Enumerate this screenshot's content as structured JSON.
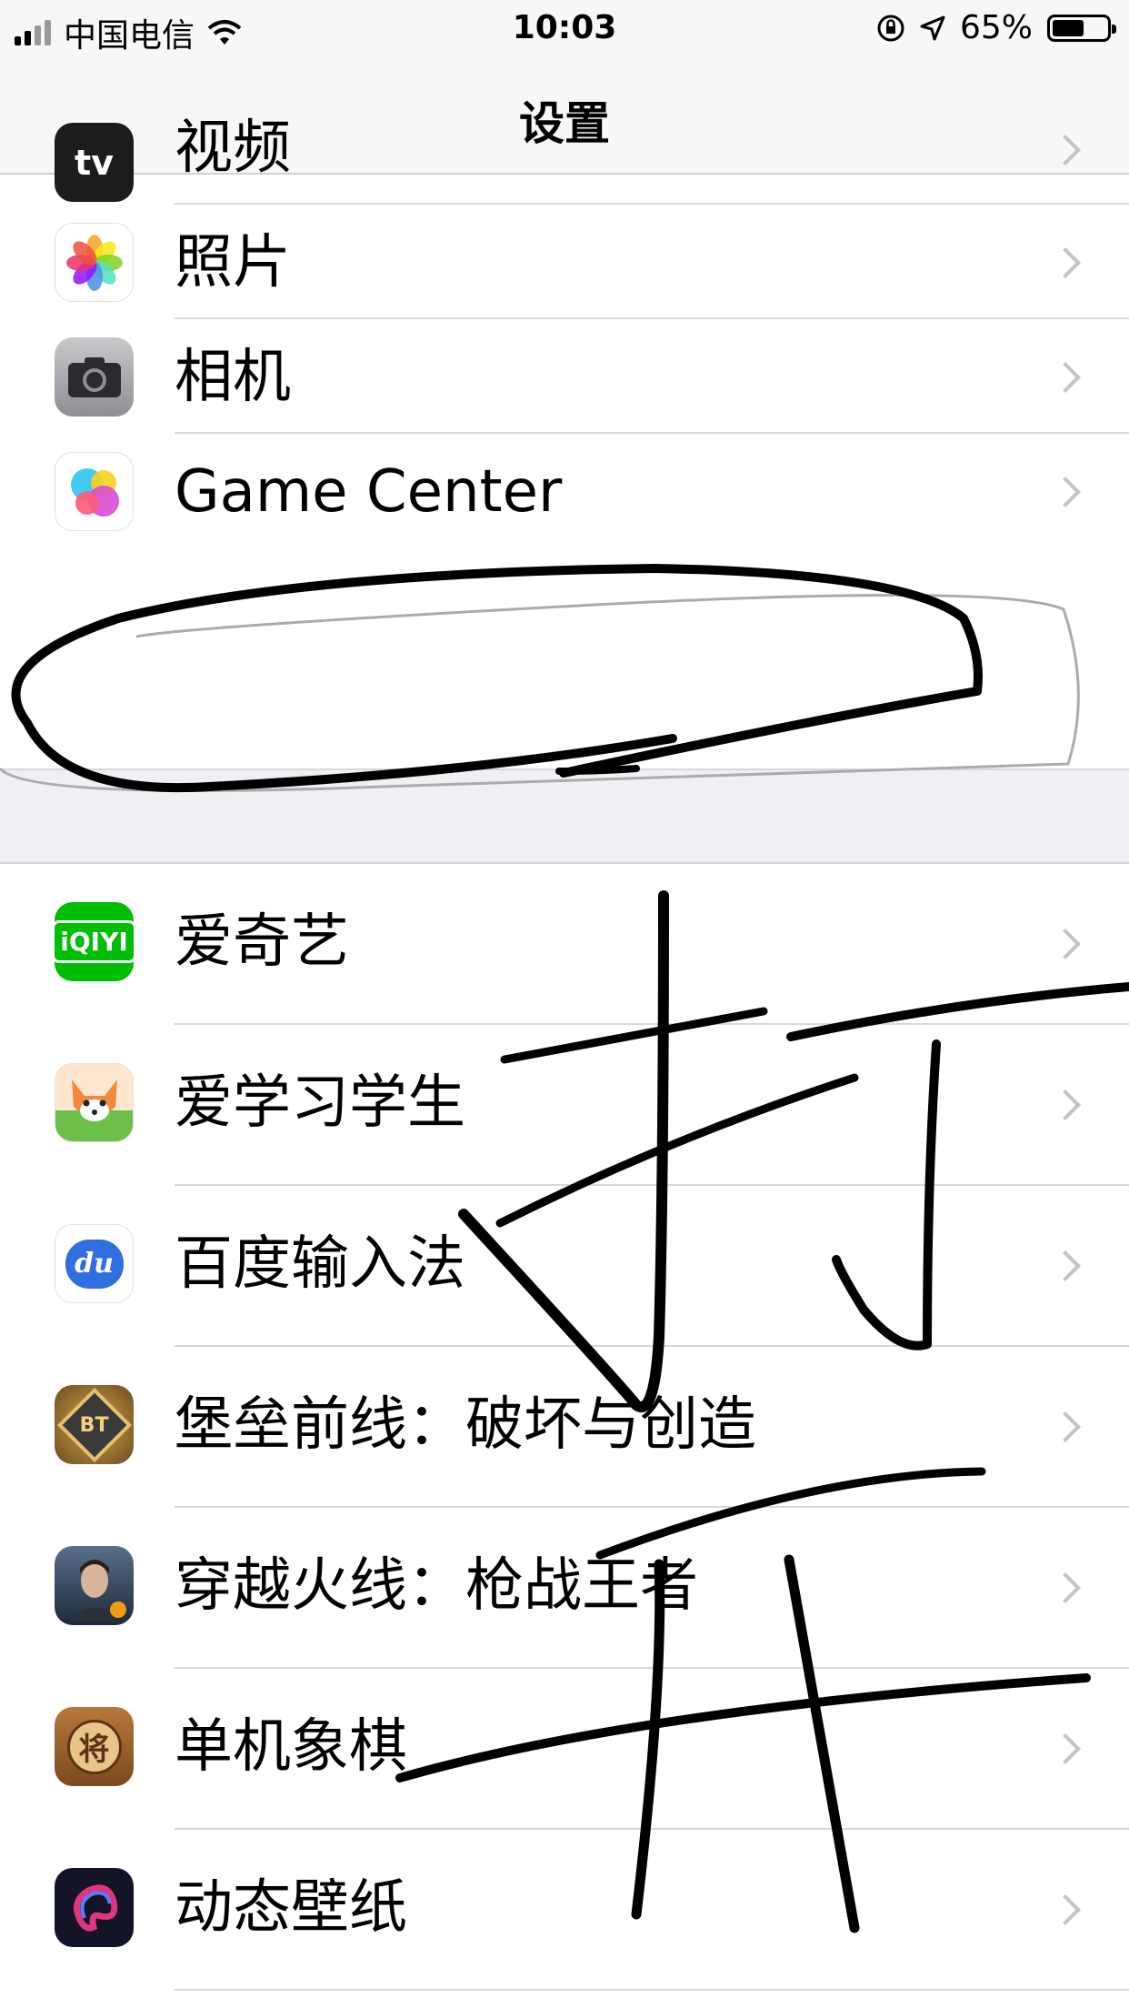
{
  "status_bar": {
    "carrier": "中国电信",
    "time": "10:03",
    "battery_percent": "65%",
    "battery_level": 0.65
  },
  "nav": {
    "title": "设置"
  },
  "group1": [
    {
      "label": "视频",
      "icon": "apple-tv-icon",
      "icon_text": "tv"
    },
    {
      "label": "照片",
      "icon": "photos-icon"
    },
    {
      "label": "相机",
      "icon": "camera-icon"
    },
    {
      "label": "Game Center",
      "icon": "game-center-icon"
    }
  ],
  "group2": [
    {
      "label": "爱奇艺",
      "icon": "iqiyi-icon",
      "icon_text": "iQIYI"
    },
    {
      "label": "爱学习学生",
      "icon": "fox-app-icon"
    },
    {
      "label": "百度输入法",
      "icon": "baidu-input-icon",
      "icon_text": "du"
    },
    {
      "label": "堡垒前线：破坏与创造",
      "icon": "bt-game-icon",
      "icon_text": "BT"
    },
    {
      "label": "穿越火线：枪战王者",
      "icon": "crossfire-icon"
    },
    {
      "label": "单机象棋",
      "icon": "chess-icon",
      "icon_text": "将"
    },
    {
      "label": "动态壁纸",
      "icon": "live-wallpaper-icon"
    }
  ],
  "colors": {
    "iqiyi": "#00be06",
    "nav_bg": "#f7f7f7",
    "group_gap": "#efeff4",
    "chevron": "#c4c4c8"
  }
}
